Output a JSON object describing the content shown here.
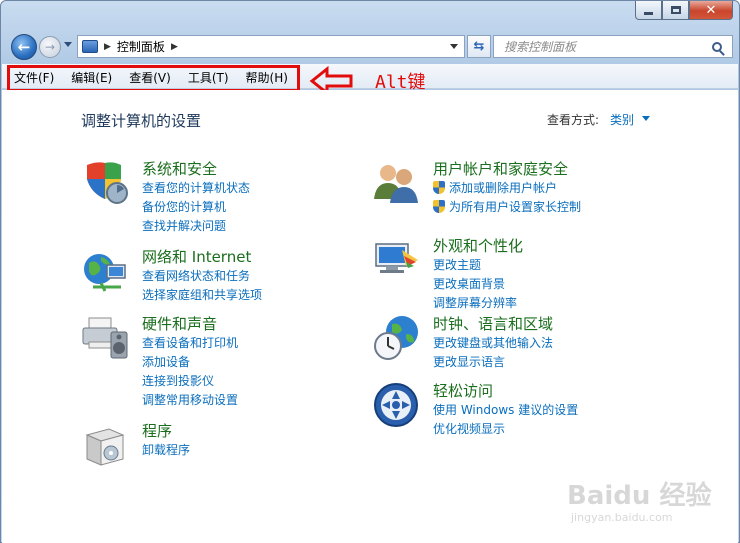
{
  "window": {
    "caption_buttons": [
      "minimize",
      "maximize",
      "close"
    ]
  },
  "nav": {
    "address_path": "控制面板",
    "search_placeholder": "搜索控制面板"
  },
  "menubar": {
    "items": [
      "文件(F)",
      "编辑(E)",
      "查看(V)",
      "工具(T)",
      "帮助(H)"
    ],
    "annotation_label": "Alt键",
    "highlight_color": "#e20c0c"
  },
  "content": {
    "page_title": "调整计算机的设置",
    "view_by_label": "查看方式:",
    "view_by_value": "类别",
    "categories": [
      {
        "icon": "security-shield-icon",
        "title": "系统和安全",
        "links": [
          "查看您的计算机状态",
          "备份您的计算机",
          "查找并解决问题"
        ]
      },
      {
        "icon": "network-globe-icon",
        "title": "网络和 Internet",
        "links": [
          "查看网络状态和任务",
          "选择家庭组和共享选项"
        ]
      },
      {
        "icon": "printer-speaker-icon",
        "title": "硬件和声音",
        "links": [
          "查看设备和打印机",
          "添加设备",
          "连接到投影仪",
          "调整常用移动设置"
        ]
      },
      {
        "icon": "programs-box-icon",
        "title": "程序",
        "links": [
          "卸载程序"
        ]
      },
      {
        "icon": "user-accounts-icon",
        "title": "用户帐户和家庭安全",
        "links": [
          "添加或删除用户帐户",
          "为所有用户设置家长控制"
        ]
      },
      {
        "icon": "appearance-monitor-icon",
        "title": "外观和个性化",
        "links": [
          "更改主题",
          "更改桌面背景",
          "调整屏幕分辨率"
        ]
      },
      {
        "icon": "clock-globe-icon",
        "title": "时钟、语言和区域",
        "links": [
          "更改键盘或其他输入法",
          "更改显示语言"
        ]
      },
      {
        "icon": "ease-of-access-icon",
        "title": "轻松访问",
        "links": [
          "使用 Windows 建议的设置",
          "优化视频显示"
        ]
      }
    ]
  },
  "watermark": {
    "text": "Baidu 经验",
    "sub": "jingyan.baidu.com"
  }
}
